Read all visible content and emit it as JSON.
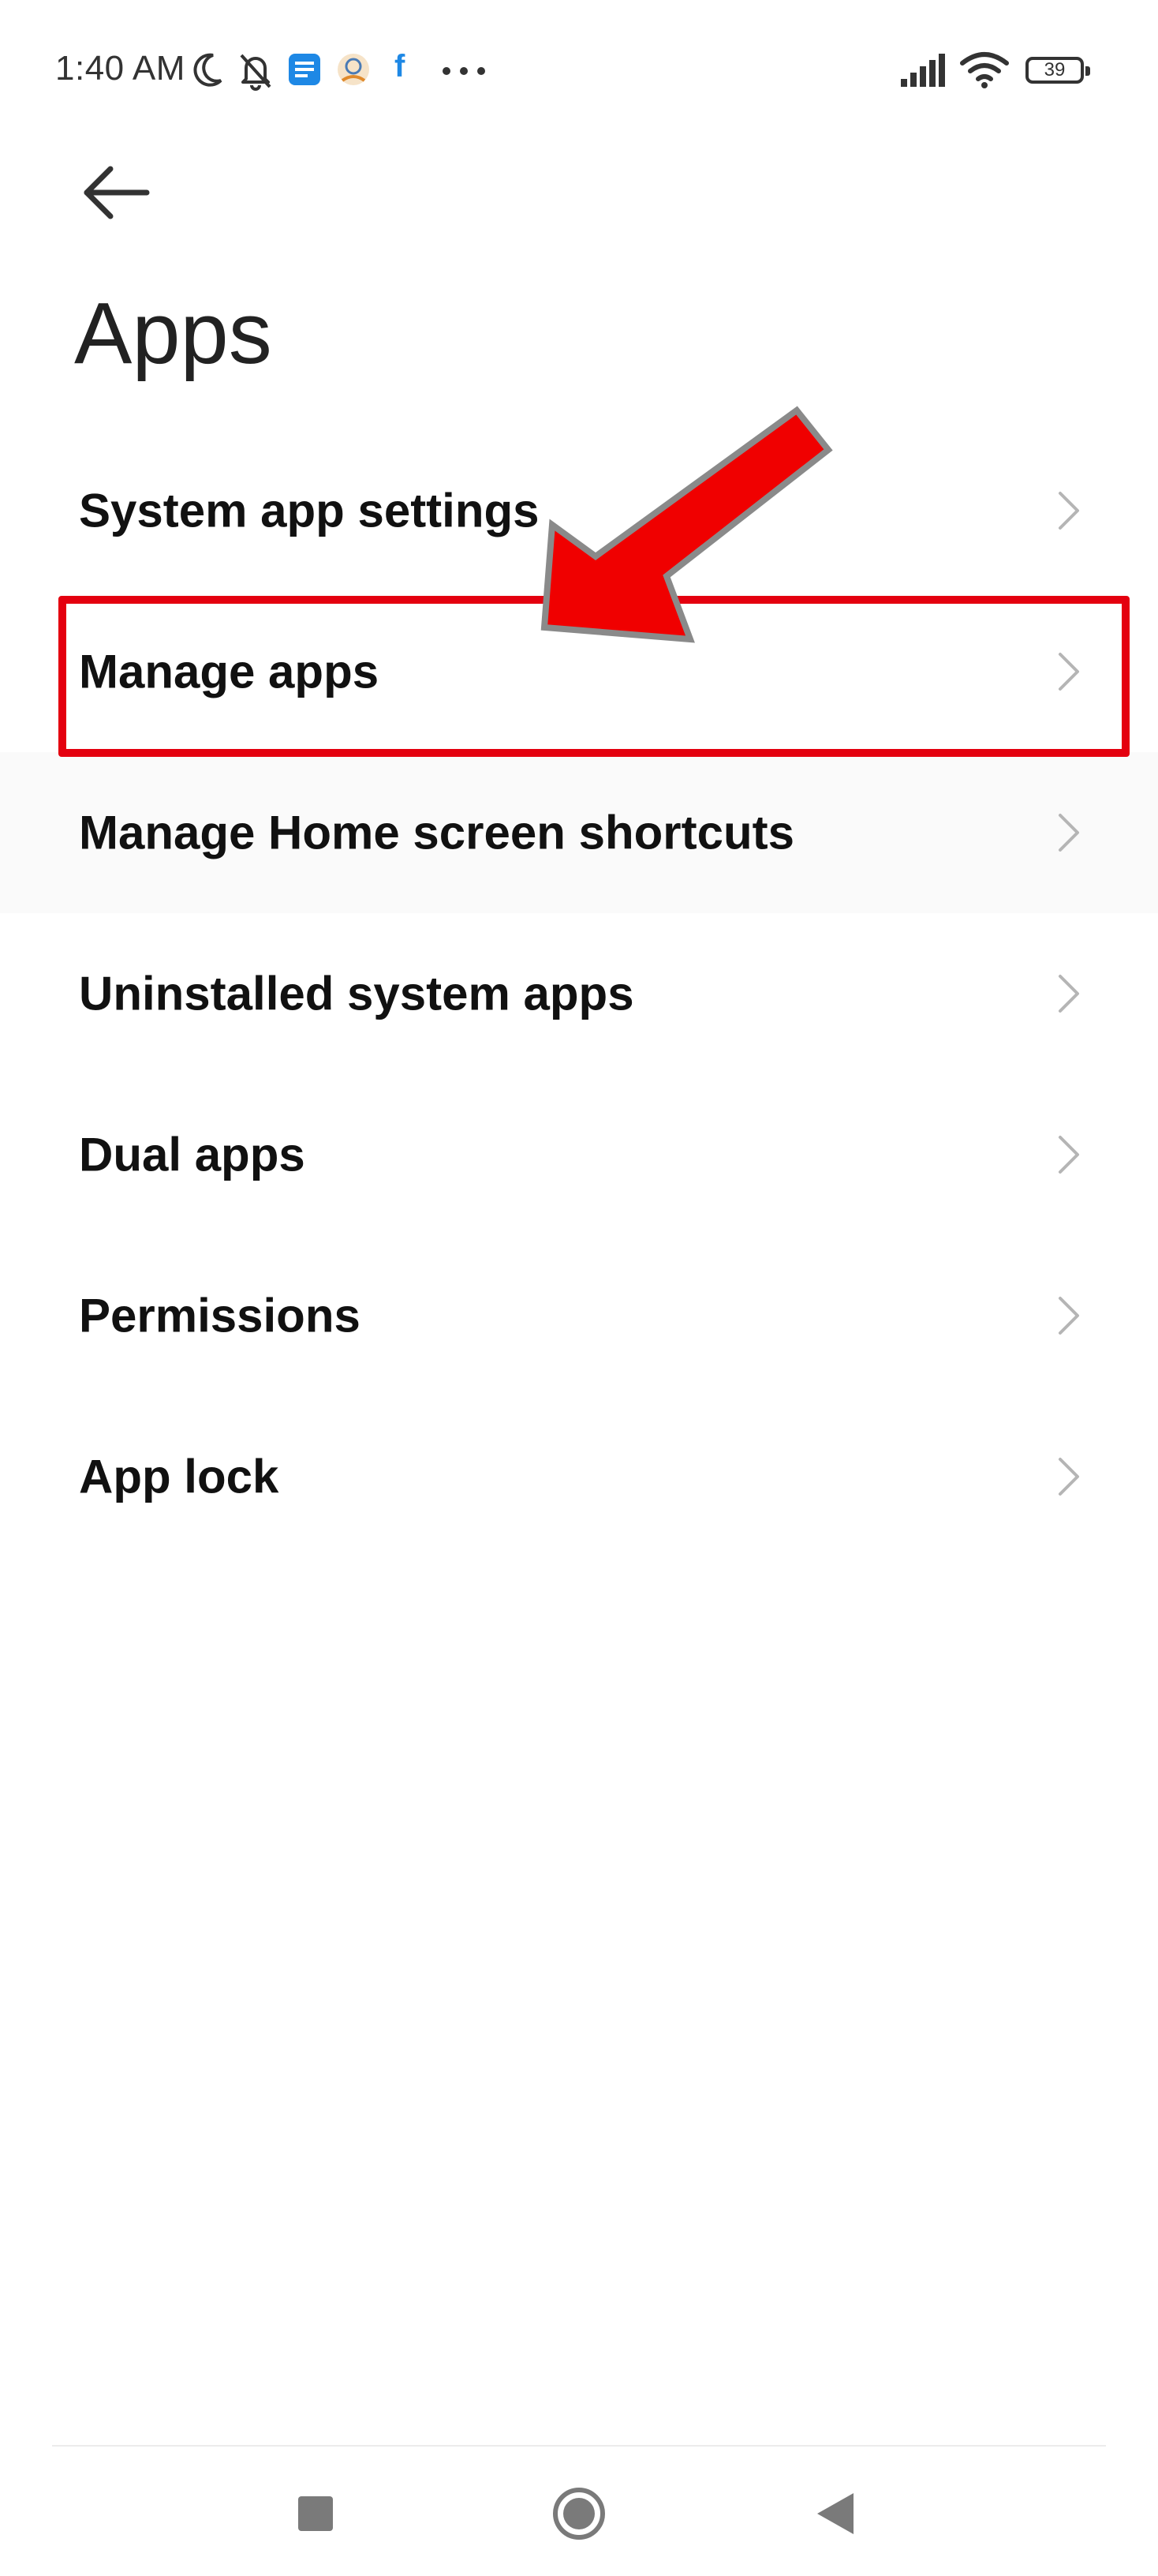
{
  "status_bar": {
    "time": "1:40 AM",
    "battery": "39",
    "left_icons": [
      "moon-icon",
      "bell-off-icon",
      "message-icon",
      "app-icon",
      "facebook-icon",
      "more-icon"
    ],
    "right_icons": [
      "signal-icon",
      "wifi-icon",
      "battery-icon"
    ],
    "facebook_letter": "f"
  },
  "header": {
    "back_icon": "arrow-left-icon",
    "title": "Apps"
  },
  "menu": {
    "items": [
      {
        "label": "System app settings"
      },
      {
        "label": "Manage apps"
      },
      {
        "label": "Manage Home screen shortcuts"
      },
      {
        "label": "Uninstalled system apps"
      },
      {
        "label": "Dual apps"
      },
      {
        "label": "Permissions"
      },
      {
        "label": "App lock"
      }
    ],
    "chevron_icon": "chevron-right-icon"
  },
  "annotation": {
    "highlighted_item": "Manage apps",
    "box_color": "#e4000f",
    "arrow_color": "#f00000"
  },
  "nav_bar": {
    "buttons": [
      "recents-square-icon",
      "home-circle-icon",
      "back-triangle-icon"
    ]
  },
  "colors": {
    "background": "#ffffff",
    "text": "#111111",
    "chevron": "#b5b5b5",
    "wifi_accent": "#1e88e5"
  }
}
